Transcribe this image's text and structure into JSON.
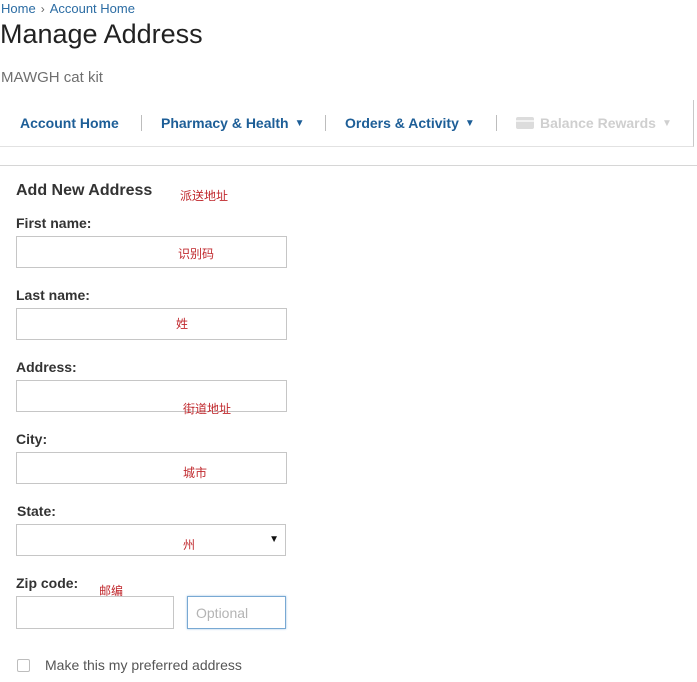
{
  "breadcrumb": {
    "home": "Home",
    "separator": "›",
    "current": "Account Home"
  },
  "page_title": "Manage Address",
  "account_name": "MAWGH cat kit",
  "nav": {
    "items": [
      {
        "label": "Account Home"
      },
      {
        "label": "Pharmacy & Health",
        "caret": "▼"
      },
      {
        "label": "Orders & Activity",
        "caret": "▼"
      },
      {
        "label": "Balance Rewards",
        "caret": "▼",
        "icon": "credit-card-icon"
      }
    ]
  },
  "form": {
    "title": "Add New Address",
    "title_annotation": "派送地址",
    "first_name": {
      "label": "First name:",
      "annotation": "识别码"
    },
    "last_name": {
      "label": "Last name:",
      "annotation": "姓"
    },
    "address": {
      "label": "Address:",
      "annotation": "街道地址"
    },
    "city": {
      "label": "City:",
      "annotation": "城市"
    },
    "state": {
      "label": "State:",
      "annotation": "州",
      "caret": "▼"
    },
    "zip": {
      "label": "Zip code:",
      "annotation": "邮编",
      "optional_placeholder": "Optional"
    },
    "preferred_checkbox": {
      "label": "Make this my preferred address",
      "checked": false
    }
  },
  "colors": {
    "link": "#2b6ca3",
    "nav_text": "#1d5e97",
    "annotation": "#c0282d",
    "disabled": "#cfcfcf"
  }
}
